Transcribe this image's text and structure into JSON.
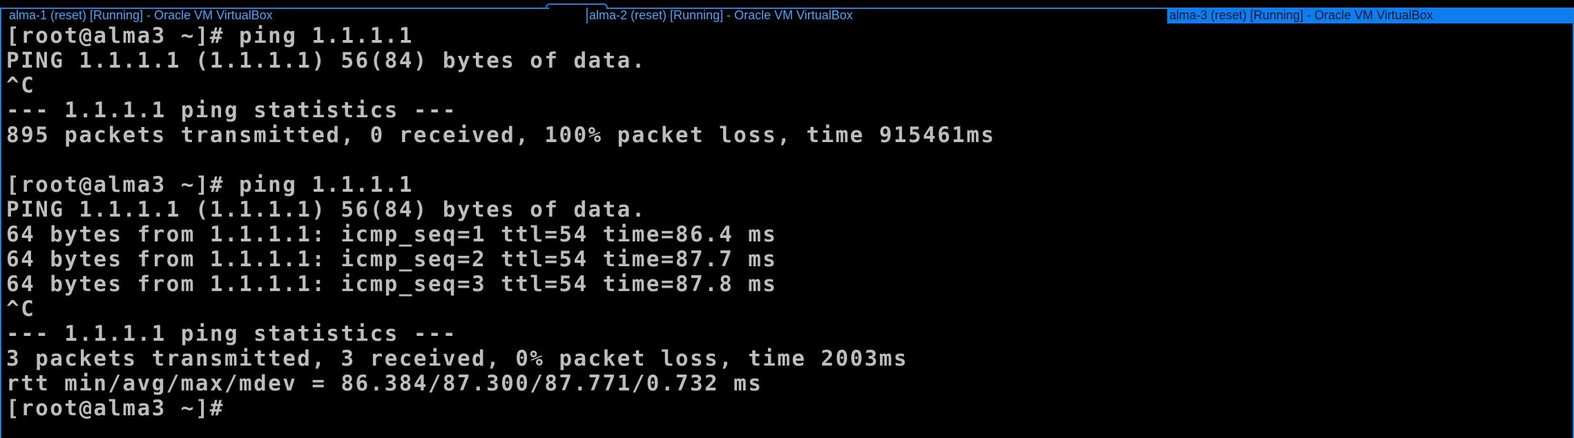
{
  "tabs": [
    {
      "title": "alma-1 (reset) [Running] - Oracle VM VirtualBox",
      "active": false
    },
    {
      "title": "alma-2 (reset) [Running] - Oracle VM VirtualBox",
      "active": false
    },
    {
      "title": "alma-3 (reset) [Running] - Oracle VM VirtualBox",
      "active": true
    }
  ],
  "console": {
    "lines": [
      "[root@alma3 ~]# ping 1.1.1.1",
      "PING 1.1.1.1 (1.1.1.1) 56(84) bytes of data.",
      "^C",
      "--- 1.1.1.1 ping statistics ---",
      "895 packets transmitted, 0 received, 100% packet loss, time 915461ms",
      "",
      "[root@alma3 ~]# ping 1.1.1.1",
      "PING 1.1.1.1 (1.1.1.1) 56(84) bytes of data.",
      "64 bytes from 1.1.1.1: icmp_seq=1 ttl=54 time=86.4 ms",
      "64 bytes from 1.1.1.1: icmp_seq=2 ttl=54 time=87.7 ms",
      "64 bytes from 1.1.1.1: icmp_seq=3 ttl=54 time=87.8 ms",
      "^C",
      "--- 1.1.1.1 ping statistics ---",
      "3 packets transmitted, 3 received, 0% packet loss, time 2003ms",
      "rtt min/avg/max/mdev = 86.384/87.300/87.771/0.732 ms",
      "[root@alma3 ~]#"
    ]
  },
  "colors": {
    "accent": "#1e7fe0",
    "active_tab": "#0d7df0",
    "console_text": "#bdbdbd",
    "background": "#000000"
  }
}
